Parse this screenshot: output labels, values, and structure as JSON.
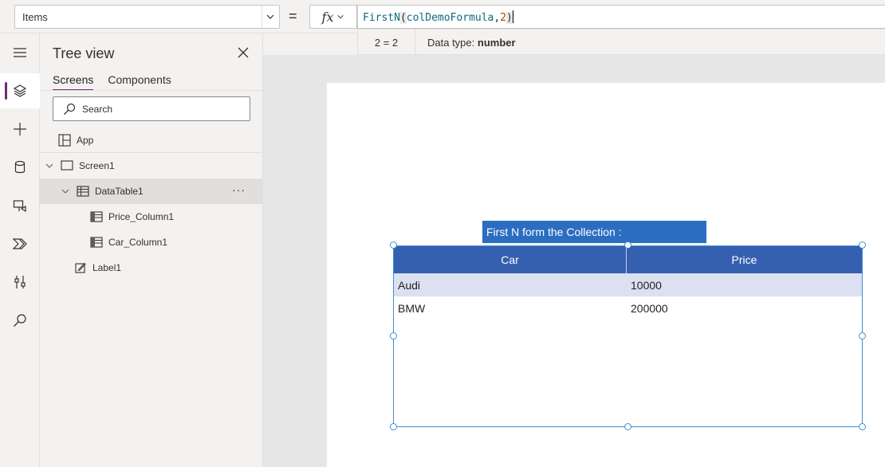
{
  "formula_bar": {
    "property": "Items",
    "equals": "=",
    "fx": "fx",
    "formula": {
      "fn": "FirstN",
      "open": "(",
      "arg1": "colDemoFormula",
      "comma": ",",
      "arg2": "2",
      "close": ")"
    },
    "result": "2 = 2",
    "data_type_label": "Data type:",
    "data_type_value": "number"
  },
  "tree": {
    "title": "Tree view",
    "tabs": [
      "Screens",
      "Components"
    ],
    "search_placeholder": "Search",
    "items": {
      "app": "App",
      "screen": "Screen1",
      "datatable": "DataTable1",
      "price_col": "Price_Column1",
      "car_col": "Car_Column1",
      "label": "Label1"
    },
    "more": "···"
  },
  "canvas": {
    "label_text": "First N form the Collection :",
    "table": {
      "headers": [
        "Car",
        "Price"
      ],
      "rows": [
        [
          "Audi",
          "10000"
        ],
        [
          "BMW",
          "200000"
        ]
      ]
    }
  },
  "colors": {
    "accent": "#742774",
    "header_bg": "#3560b0",
    "label_bg": "#2b6dc1",
    "row_alt": "#dbe1f1",
    "selection": "#3d8fd1"
  }
}
